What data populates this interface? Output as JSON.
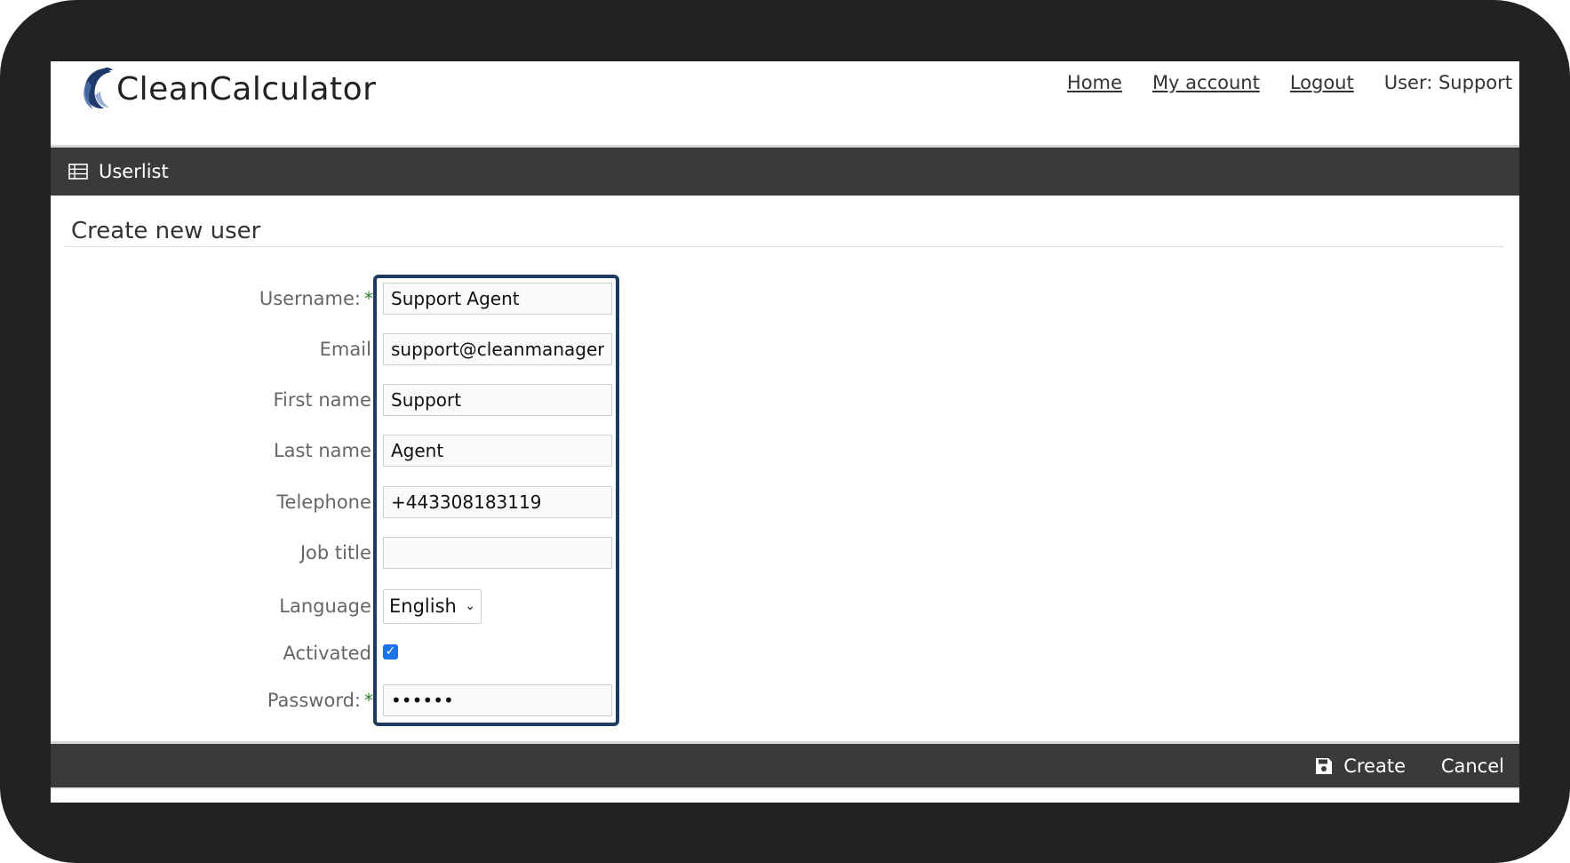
{
  "header": {
    "logo_text": "CleanCalculator",
    "nav": [
      {
        "label": "Home"
      },
      {
        "label": "My account"
      },
      {
        "label": "Logout"
      }
    ],
    "user_label": "User: Support"
  },
  "titlebar": {
    "icon": "table-icon",
    "title": "Userlist"
  },
  "content": {
    "title": "Create new user"
  },
  "form": {
    "username": {
      "label": "Username:",
      "value": "Support Agent",
      "required": "*"
    },
    "email": {
      "label": "Email:",
      "value": "support@cleanmanager."
    },
    "first_name": {
      "label": "First name:",
      "value": "Support"
    },
    "last_name": {
      "label": "Last name:",
      "value": "Agent"
    },
    "telephone": {
      "label": "Telephone:",
      "value": "+443308183119"
    },
    "job_title": {
      "label": "Job title:",
      "value": ""
    },
    "language": {
      "label": "Language:",
      "value": "English"
    },
    "activated": {
      "label": "Activated:",
      "checked": true
    },
    "password": {
      "label": "Password:",
      "value": "••••••",
      "required": "*"
    }
  },
  "footer": {
    "create_label": "Create",
    "create_icon": "save-icon",
    "cancel_label": "Cancel"
  },
  "colors": {
    "bar": "#3a3a3a",
    "highlight": "#1f3a5f",
    "required": "#2e7d32",
    "checkbox": "#1a73e8"
  }
}
